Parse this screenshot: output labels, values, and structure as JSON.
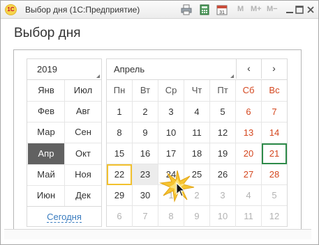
{
  "window": {
    "logo_text": "1С",
    "title": "Выбор дня  (1С:Предприятие)",
    "toolbar_letters": [
      "M",
      "M+",
      "M−"
    ]
  },
  "heading": "Выбор дня",
  "year_field": "2019",
  "month_field": "Апрель",
  "nav": {
    "prev": "‹",
    "next": "›"
  },
  "months": [
    [
      "Янв",
      "Июл"
    ],
    [
      "Фев",
      "Авг"
    ],
    [
      "Мар",
      "Сен"
    ],
    [
      "Апр",
      "Окт"
    ],
    [
      "Май",
      "Ноя"
    ],
    [
      "Июн",
      "Дек"
    ]
  ],
  "selected_month": "Апр",
  "today_link": "Сегодня",
  "weekdays": [
    "Пн",
    "Вт",
    "Ср",
    "Чт",
    "Пт",
    "Сб",
    "Вс"
  ],
  "weeks": [
    [
      "1",
      "2",
      "3",
      "4",
      "5",
      "6",
      "7"
    ],
    [
      "8",
      "9",
      "10",
      "11",
      "12",
      "13",
      "14"
    ],
    [
      "15",
      "16",
      "17",
      "18",
      "19",
      "20",
      "21"
    ],
    [
      "22",
      "23",
      "24",
      "25",
      "26",
      "27",
      "28"
    ],
    [
      "29",
      "30",
      "1",
      "2",
      "3",
      "4",
      "5"
    ],
    [
      "6",
      "7",
      "8",
      "9",
      "10",
      "11",
      "12"
    ]
  ],
  "today_day": "21",
  "selected_day": "22",
  "hover_day": "23",
  "colors": {
    "weekend": "#d4471f",
    "today_border": "#2e8b4a",
    "selected_border": "#f2c12e",
    "selected_month_bg": "#616161",
    "link": "#3a7cbf"
  }
}
